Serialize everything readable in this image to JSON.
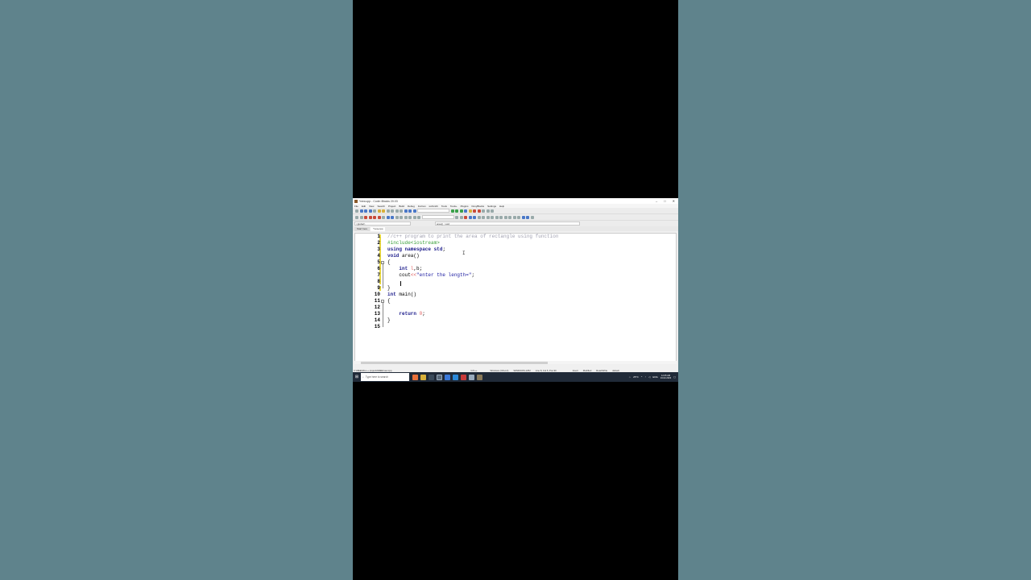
{
  "window": {
    "title": "*new.cpp - Code::Blocks 20.03",
    "controls": [
      "–",
      "□",
      "✕"
    ]
  },
  "menu": [
    "File",
    "Edit",
    "View",
    "Search",
    "Project",
    "Build",
    "Debug",
    "Fortran",
    "wxSmith",
    "Tools",
    "Tools+",
    "Plugins",
    "DoxyBlocks",
    "Settings",
    "Help"
  ],
  "scope": {
    "left": "<global>",
    "right": "area() : void"
  },
  "tabs": [
    {
      "label": "Start here"
    },
    {
      "label": "*new.cpp"
    }
  ],
  "code": {
    "line_numbers": [
      "1",
      "2",
      "3",
      "4",
      "5",
      "6",
      "7",
      "8",
      "9",
      "10",
      "11",
      "12",
      "13",
      "14",
      "15"
    ],
    "lines": [
      [
        {
          "c": "cmt",
          "t": "//c++ program to print the area of rectangle using function"
        }
      ],
      [
        {
          "c": "pp",
          "t": "#include<iostream>"
        }
      ],
      [
        {
          "c": "kw",
          "t": "using namespace"
        },
        {
          "c": "",
          "t": " "
        },
        {
          "c": "kw",
          "t": "std"
        },
        {
          "c": "",
          "t": ";"
        }
      ],
      [
        {
          "c": "kw",
          "t": "void"
        },
        {
          "c": "",
          "t": " area()"
        }
      ],
      [
        {
          "c": "",
          "t": "{"
        }
      ],
      [
        {
          "c": "",
          "t": "    "
        },
        {
          "c": "kw",
          "t": "int"
        },
        {
          "c": "",
          "t": " "
        },
        {
          "c": "num",
          "t": "l"
        },
        {
          "c": "",
          "t": ",b;"
        }
      ],
      [
        {
          "c": "",
          "t": "    cout"
        },
        {
          "c": "op",
          "t": "<<"
        },
        {
          "c": "str",
          "t": "\"enter the length=\""
        },
        {
          "c": "",
          "t": ";"
        }
      ],
      [
        {
          "c": "",
          "t": ""
        }
      ],
      [
        {
          "c": "",
          "t": "}"
        }
      ],
      [
        {
          "c": "kw",
          "t": "int"
        },
        {
          "c": "",
          "t": " main()"
        }
      ],
      [
        {
          "c": "",
          "t": "{"
        }
      ],
      [
        {
          "c": "",
          "t": ""
        }
      ],
      [
        {
          "c": "",
          "t": "    "
        },
        {
          "c": "kw",
          "t": "return"
        },
        {
          "c": "",
          "t": " "
        },
        {
          "c": "num",
          "t": "0"
        },
        {
          "c": "",
          "t": ";"
        }
      ],
      [
        {
          "c": "",
          "t": "}"
        }
      ],
      [
        {
          "c": "",
          "t": ""
        }
      ]
    ]
  },
  "status": {
    "path": "C:\\MEENA\\c++ projects\\MEE\\new.cpp",
    "lang": "C/C++",
    "eol": "Windows (CR+LF)",
    "encoding": "WINDOWS-1252",
    "position": "Line 8, Col 5, Pos 90",
    "mode": "Insert",
    "modified": "Modified",
    "rw": "Read/Write",
    "profile": "default"
  },
  "taskbar": {
    "start_icon": "windows-logo-icon",
    "search_placeholder": "Type here to search",
    "weather": "25°C",
    "lang": "ENG",
    "time": "12:45 AM",
    "date": "16-02-2023"
  },
  "colors": {
    "comment": "#a0a0b0",
    "preprocessor": "#3aa03a",
    "keyword": "#1a1a8a",
    "number": "#e06060",
    "string": "#1a1aa0",
    "background": "#5f838c"
  }
}
